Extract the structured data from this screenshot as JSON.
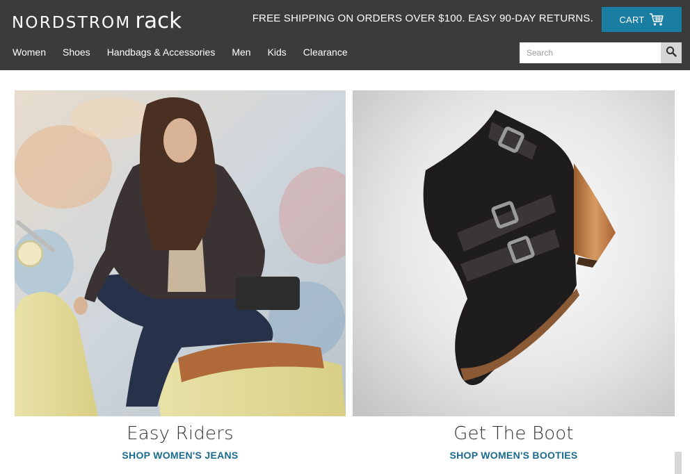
{
  "header": {
    "logo": {
      "primary": "NORDSTROM",
      "secondary": "rack"
    },
    "promo_text": "FREE SHIPPING ON ORDERS OVER $100. EASY 90-DAY RETURNS.",
    "cart_label": "CART",
    "search_placeholder": "Search",
    "nav": [
      "Women",
      "Shoes",
      "Handbags & Accessories",
      "Men",
      "Kids",
      "Clearance"
    ]
  },
  "tiles": [
    {
      "title": "Easy Riders",
      "link": "SHOP WOMEN'S JEANS"
    },
    {
      "title": "Get The Boot",
      "link": "SHOP WOMEN'S BOOTIES"
    }
  ],
  "colors": {
    "header_bg": "#3b3b3b",
    "accent": "#1a7ea2",
    "link": "#1a6a8d"
  },
  "icons": {
    "cart": "shopping-cart-icon",
    "search": "search-icon"
  }
}
